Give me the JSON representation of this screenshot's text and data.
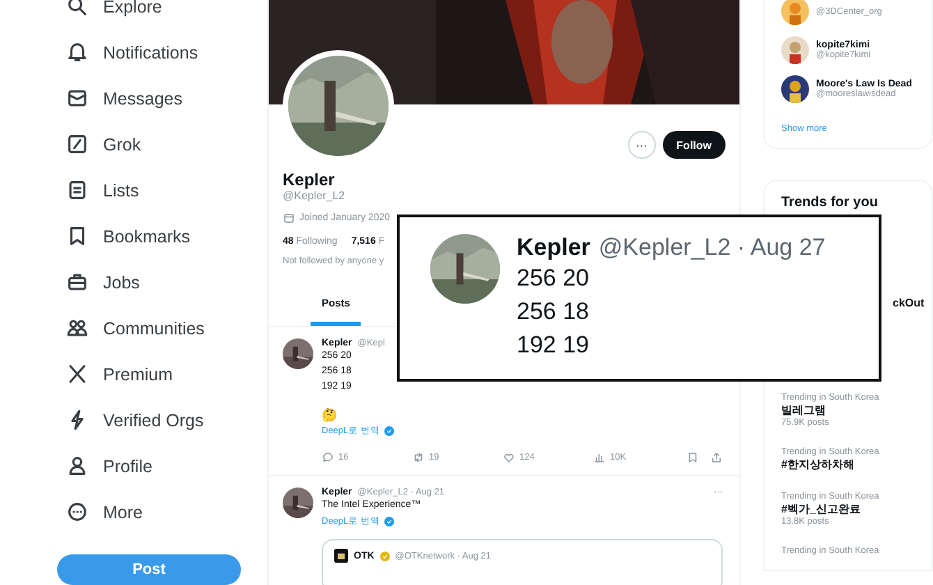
{
  "sidebar": {
    "items": [
      {
        "label": "Explore"
      },
      {
        "label": "Notifications"
      },
      {
        "label": "Messages"
      },
      {
        "label": "Grok"
      },
      {
        "label": "Lists"
      },
      {
        "label": "Bookmarks"
      },
      {
        "label": "Jobs"
      },
      {
        "label": "Communities"
      },
      {
        "label": "Premium"
      },
      {
        "label": "Verified Orgs"
      },
      {
        "label": "Profile"
      },
      {
        "label": "More"
      }
    ],
    "post_button": "Post"
  },
  "profile": {
    "more_button": "···",
    "follow_button": "Follow",
    "name": "Kepler",
    "handle": "@Kepler_L2",
    "joined": "Joined January 2020",
    "following_count": "48",
    "following_label": "Following",
    "followers_count": "7,516",
    "followers_label": "F",
    "not_followed": "Not followed by anyone y"
  },
  "tabs": [
    {
      "label": "Posts",
      "selected": true
    }
  ],
  "tweets": [
    {
      "name": "Kepler",
      "meta": "@Kepl",
      "lines": [
        "256 20",
        "256 18",
        "192 19"
      ],
      "emoji": "🤔",
      "translate": "DeepL로 번역",
      "actions": {
        "replies": "16",
        "reposts": "19",
        "likes": "124",
        "views": "10K"
      }
    },
    {
      "name": "Kepler",
      "meta": "@Kepler_L2 · Aug 21",
      "more": "···",
      "lines": [
        "The Intel Experience™"
      ],
      "translate": "DeepL로 번역",
      "quote": {
        "name": "OTK",
        "meta": "@OTKnetwork · Aug 21"
      }
    }
  ],
  "who_to_follow": {
    "accounts": [
      {
        "handle": "@3DCenter_org"
      },
      {
        "name": "kopite7kimi",
        "handle": "@kopite7kimi"
      },
      {
        "name": "Moore's Law Is Dead",
        "handle": "@mooreslawisdead"
      }
    ],
    "show_more": "Show more"
  },
  "trends": {
    "title": "Trends for you",
    "items": [
      {
        "name": "ckOut"
      },
      {
        "context": "Trending in South Korea",
        "name": "빌레그램",
        "posts": "75.9K posts"
      },
      {
        "context": "Trending in South Korea",
        "name": "#한지상하차해"
      },
      {
        "context": "Trending in South Korea",
        "name": "#벡가_신고완료",
        "posts": "13.8K posts"
      },
      {
        "context": "Trending in South Korea"
      }
    ]
  },
  "callout": {
    "name": "Kepler",
    "meta": "@Kepler_L2 · Aug 27",
    "lines": [
      "256 20",
      "256 18",
      "192 19"
    ]
  }
}
